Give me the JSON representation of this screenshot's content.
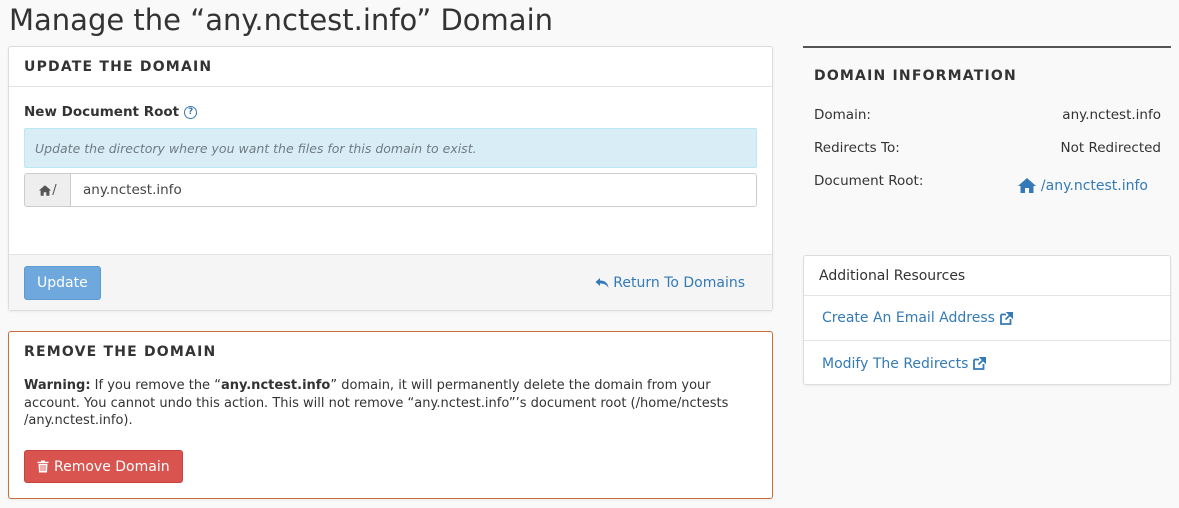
{
  "page": {
    "title": "Manage the “any.nctest.info” Domain"
  },
  "update_panel": {
    "heading": "Update the Domain",
    "field_label": "New Document Root",
    "help_icon": "question-circle-icon",
    "info_text": "Update the directory where you want the files for this domain to exist.",
    "addon_icon": "home-icon",
    "addon_text": "/",
    "input_value": "any.nctest.info",
    "update_label": "Update",
    "return_icon": "reply-arrow-icon",
    "return_label": "Return To Domains"
  },
  "remove_panel": {
    "heading": "Remove the Domain",
    "warning_label": "Warning:",
    "warning_part1": " If you remove the “",
    "warning_domain": "any.nctest.info",
    "warning_part2": "” domain, it will permanently delete the domain from your account. You cannot undo this action. This will not remove “any.nctest.info”’s document root (/home/nctests /any.nctest.info).",
    "remove_icon": "trash-icon",
    "remove_label": "Remove Domain"
  },
  "domain_info": {
    "heading": "Domain Information",
    "domain_label": "Domain:",
    "domain_value": "any.nctest.info",
    "redirects_label": "Redirects To:",
    "redirects_value": "Not Redirected",
    "docroot_label": "Document Root:",
    "docroot_icon": "home-icon",
    "docroot_value": "/any.nctest.info"
  },
  "resources": {
    "heading": "Additional Resources",
    "external_icon": "external-link-icon",
    "items": [
      {
        "label": "Create An Email Address"
      },
      {
        "label": "Modify The Redirects"
      }
    ]
  },
  "colors": {
    "link": "#337ab7",
    "update_button": "#6ea8dc",
    "danger_button": "#d9534f",
    "danger_border": "#c86e3a",
    "info_alert": "#d9edf7"
  }
}
